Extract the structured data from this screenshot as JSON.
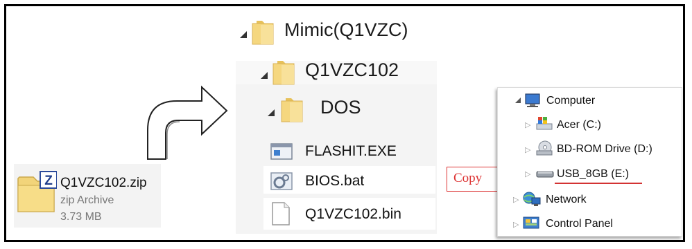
{
  "zip": {
    "name": "Q1VZC102.zip",
    "type": "zip Archive",
    "size": "3.73 MB",
    "icon": "zip-archive-icon"
  },
  "tree": {
    "root": "Mimic(Q1VZC)",
    "child": "Q1VZC102",
    "grandchild": "DOS",
    "files": [
      {
        "name": "FLASHIT.EXE",
        "icon": "exe-icon"
      },
      {
        "name": "BIOS.bat",
        "icon": "batch-file-icon"
      },
      {
        "name": "Q1VZC102.bin",
        "icon": "blank-file-icon"
      }
    ]
  },
  "callout": {
    "label": "Copy",
    "color": "#d33333"
  },
  "explorer": {
    "items": [
      {
        "label": "Computer",
        "icon": "computer-icon"
      },
      {
        "label": "Acer (C:)",
        "icon": "windows-drive-icon"
      },
      {
        "label": "BD-ROM Drive (D:)",
        "icon": "optical-drive-icon"
      },
      {
        "label": "USB_8GB (E:)",
        "icon": "usb-drive-icon"
      },
      {
        "label": "Network",
        "icon": "network-icon"
      },
      {
        "label": "Control Panel",
        "icon": "control-panel-icon"
      }
    ]
  }
}
